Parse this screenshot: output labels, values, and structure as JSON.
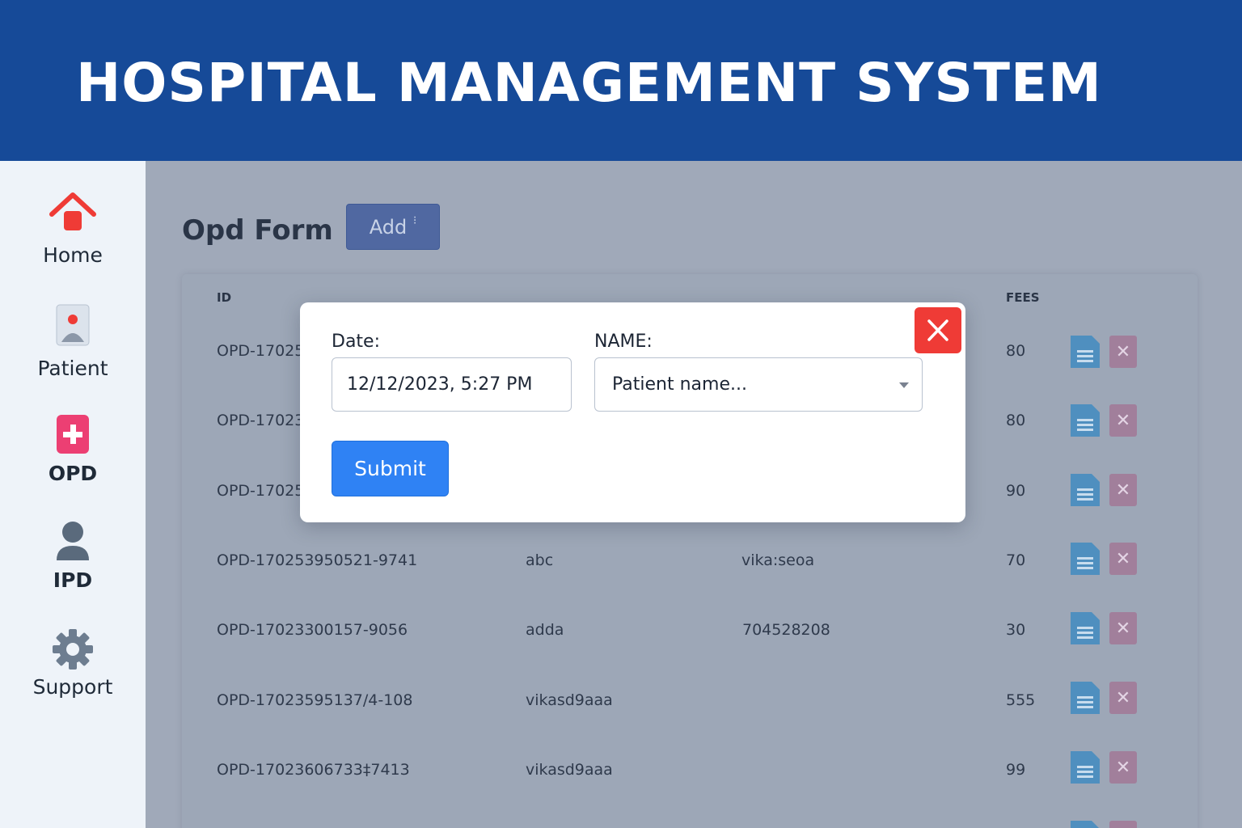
{
  "app": {
    "title": "HOSPITAL MANAGEMENT SYSTEM"
  },
  "sidebar": {
    "items": [
      {
        "label": "Home",
        "icon": "home-icon"
      },
      {
        "label": "Patient",
        "icon": "patient-icon"
      },
      {
        "label": "OPD",
        "icon": "plus-icon"
      },
      {
        "label": "IPD",
        "icon": "user-icon"
      },
      {
        "label": "Support",
        "icon": "gear-icon"
      }
    ]
  },
  "page": {
    "title": "Opd Form",
    "add_label": "Add",
    "add_suffix": "⁝"
  },
  "table": {
    "headers": {
      "id": "ID",
      "fees": "FEES"
    },
    "rows": [
      {
        "id": "OPD-170255",
        "name": "",
        "contact": "",
        "fees": "80"
      },
      {
        "id": "OPD-170235",
        "name": "",
        "contact": "",
        "fees": "80"
      },
      {
        "id": "OPD-170253",
        "name": "",
        "contact": "",
        "fees": "90"
      },
      {
        "id": "OPD-170253950521-9741",
        "name": "abc",
        "contact": "vika:seoa",
        "fees": "70"
      },
      {
        "id": "OPD-17023300157-9056",
        "name": "adda",
        "contact": "704528208",
        "fees": "30"
      },
      {
        "id": "OPD-17023595137/4-108",
        "name": "vikasd9aaa",
        "contact": "",
        "fees": "555"
      },
      {
        "id": "OPD-17023606733‡7413",
        "name": "vikasd9aaa",
        "contact": "",
        "fees": "99"
      }
    ]
  },
  "modal": {
    "date_label": "Date:",
    "date_value": "12/12/2023, 5:27 PM",
    "name_label": "NAME:",
    "name_placeholder": "Patient name...",
    "submit_label": "Submit",
    "close_icon": "close-icon"
  },
  "colors": {
    "header_bg": "#164a98",
    "sidebar_bg": "#eef3f9",
    "overlay_bg": "#a0a9b9",
    "submit": "#2f82f4",
    "close": "#ef3b36",
    "home_icon": "#ef3b36",
    "opd_icon": "#ec3f73"
  }
}
